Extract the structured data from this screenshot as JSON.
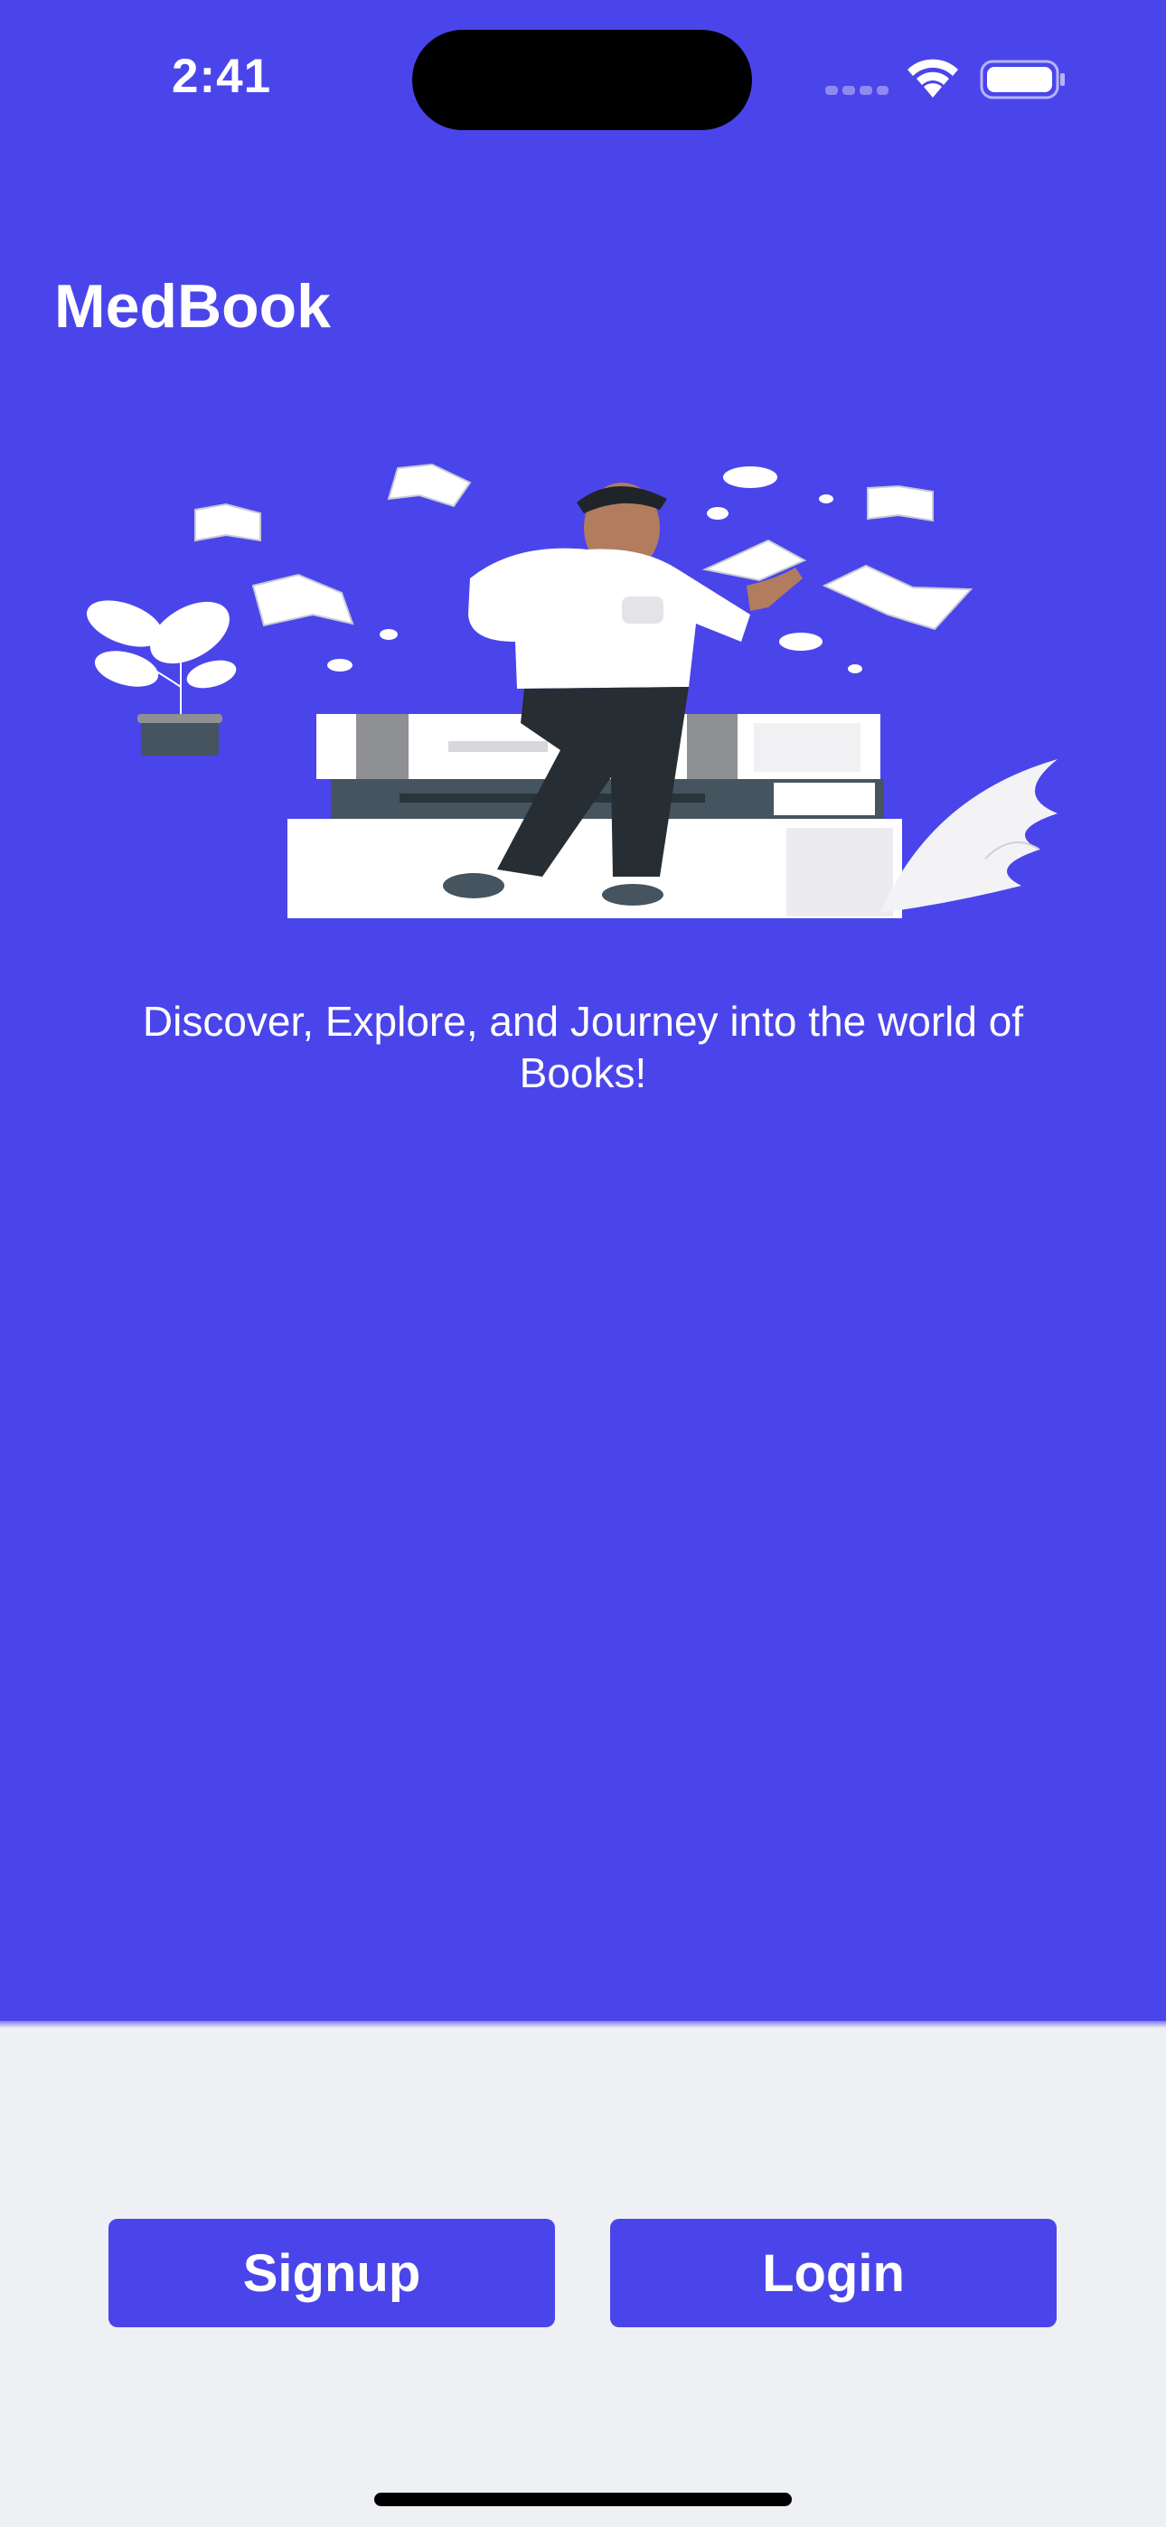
{
  "status_bar": {
    "time": "2:41",
    "icons": [
      "cellular-signal-icon",
      "wifi-icon",
      "battery-icon"
    ]
  },
  "app": {
    "title": "MedBook",
    "tagline": "Discover, Explore, and Journey into the world of Books!"
  },
  "illustration": {
    "icon": "person-reading-books-illustration"
  },
  "actions": {
    "signup_label": "Signup",
    "login_label": "Login"
  },
  "colors": {
    "primary": "#4A45EA",
    "background": "#EFF0F4",
    "text_on_primary": "#FFFFFF"
  }
}
